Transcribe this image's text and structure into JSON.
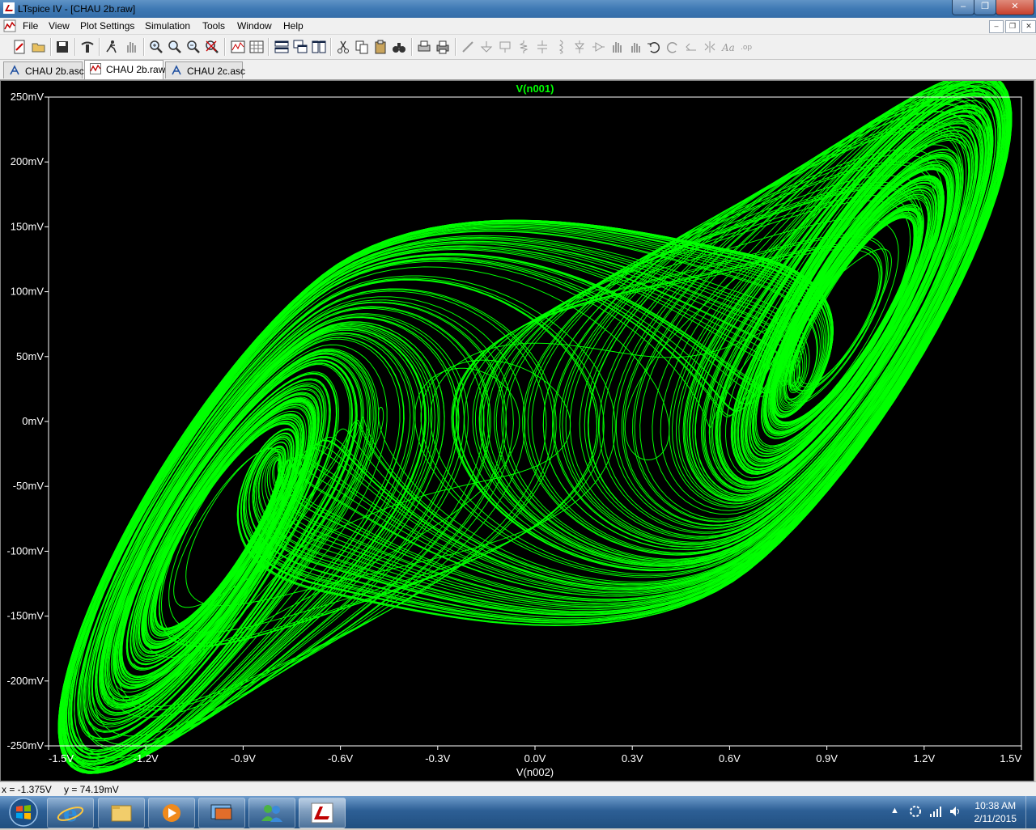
{
  "window": {
    "title": "LTspice IV - [CHAU 2b.raw]",
    "minimize_label": "‒",
    "restore_label": "❐",
    "close_label": "✕"
  },
  "menu": {
    "items": [
      {
        "label": "File",
        "icon": "ltspice-doc-icon"
      },
      {
        "label": "View"
      },
      {
        "label": "Plot Settings"
      },
      {
        "label": "Simulation"
      },
      {
        "label": "Tools"
      },
      {
        "label": "Window"
      },
      {
        "label": "Help"
      }
    ],
    "mdi_minimize": "–",
    "mdi_restore": "❐",
    "mdi_close": "✕"
  },
  "toolbar": {
    "icons": [
      "new-schematic-icon",
      "open-icon",
      "save-icon",
      "control-panel-icon",
      "run-icon",
      "halt-icon",
      "zoom-area-icon",
      "zoom-back-icon",
      "zoom-out-icon",
      "zoom-fit-icon",
      "autorange-icon",
      "grid-icon",
      "tile-horizontal-icon",
      "cascade-icon",
      "tile-vertical-icon",
      "cut-icon",
      "copy-icon",
      "paste-icon",
      "find-icon",
      "print-preview-icon",
      "print-icon",
      "wire-icon",
      "ground-icon",
      "label-icon",
      "resistor-icon",
      "capacitor-icon",
      "inductor-icon",
      "diode-icon",
      "component-icon",
      "move-icon",
      "drag-icon",
      "undo-icon",
      "redo-icon",
      "rotate-icon",
      "mirror-icon",
      "text-icon",
      "spice-directive-icon"
    ]
  },
  "tabs": [
    {
      "label": "CHAU 2b.asc",
      "icon": "schematic-icon",
      "active": false
    },
    {
      "label": "CHAU 2b.raw",
      "icon": "waveform-icon",
      "active": true
    },
    {
      "label": "CHAU 2c.asc",
      "icon": "schematic-icon",
      "active": false
    }
  ],
  "chart_data": {
    "type": "line",
    "title": "V(n001)",
    "xlabel": "V(n002)",
    "ylabel": "",
    "xlim": [
      -1.5,
      1.5
    ],
    "ylim": [
      -0.25,
      0.25
    ],
    "x_ticks": [
      "-1.5V",
      "-1.2V",
      "-0.9V",
      "-0.6V",
      "-0.3V",
      "0.0V",
      "0.3V",
      "0.6V",
      "0.9V",
      "1.2V",
      "1.5V"
    ],
    "y_ticks": [
      "250mV",
      "200mV",
      "150mV",
      "100mV",
      "50mV",
      "0mV",
      "-50mV",
      "-100mV",
      "-150mV",
      "-200mV",
      "-250mV"
    ],
    "series": [
      {
        "name": "V(n001)",
        "color": "#00ff00",
        "kind": "double-scroll phase portrait",
        "left_focus": [
          -1.13,
          -0.012
        ],
        "right_focus": [
          1.12,
          0.07
        ],
        "x_extent": [
          -1.47,
          1.47
        ],
        "y_extent": [
          -0.235,
          0.232
        ]
      }
    ],
    "background": "#000000",
    "tick_color": "#ffffff",
    "grid": false
  },
  "status": {
    "x_readout": "x = -1.375V",
    "y_readout": "y = 74.19mV"
  },
  "taskbar": {
    "apps": [
      {
        "name": "internet-explorer-icon"
      },
      {
        "name": "file-explorer-icon"
      },
      {
        "name": "media-player-icon"
      },
      {
        "name": "remote-desktop-icon"
      },
      {
        "name": "messenger-icon"
      },
      {
        "name": "ltspice-icon",
        "active": true
      }
    ],
    "tray_arrow": "▲",
    "time": "10:38 AM",
    "date": "2/11/2015"
  }
}
